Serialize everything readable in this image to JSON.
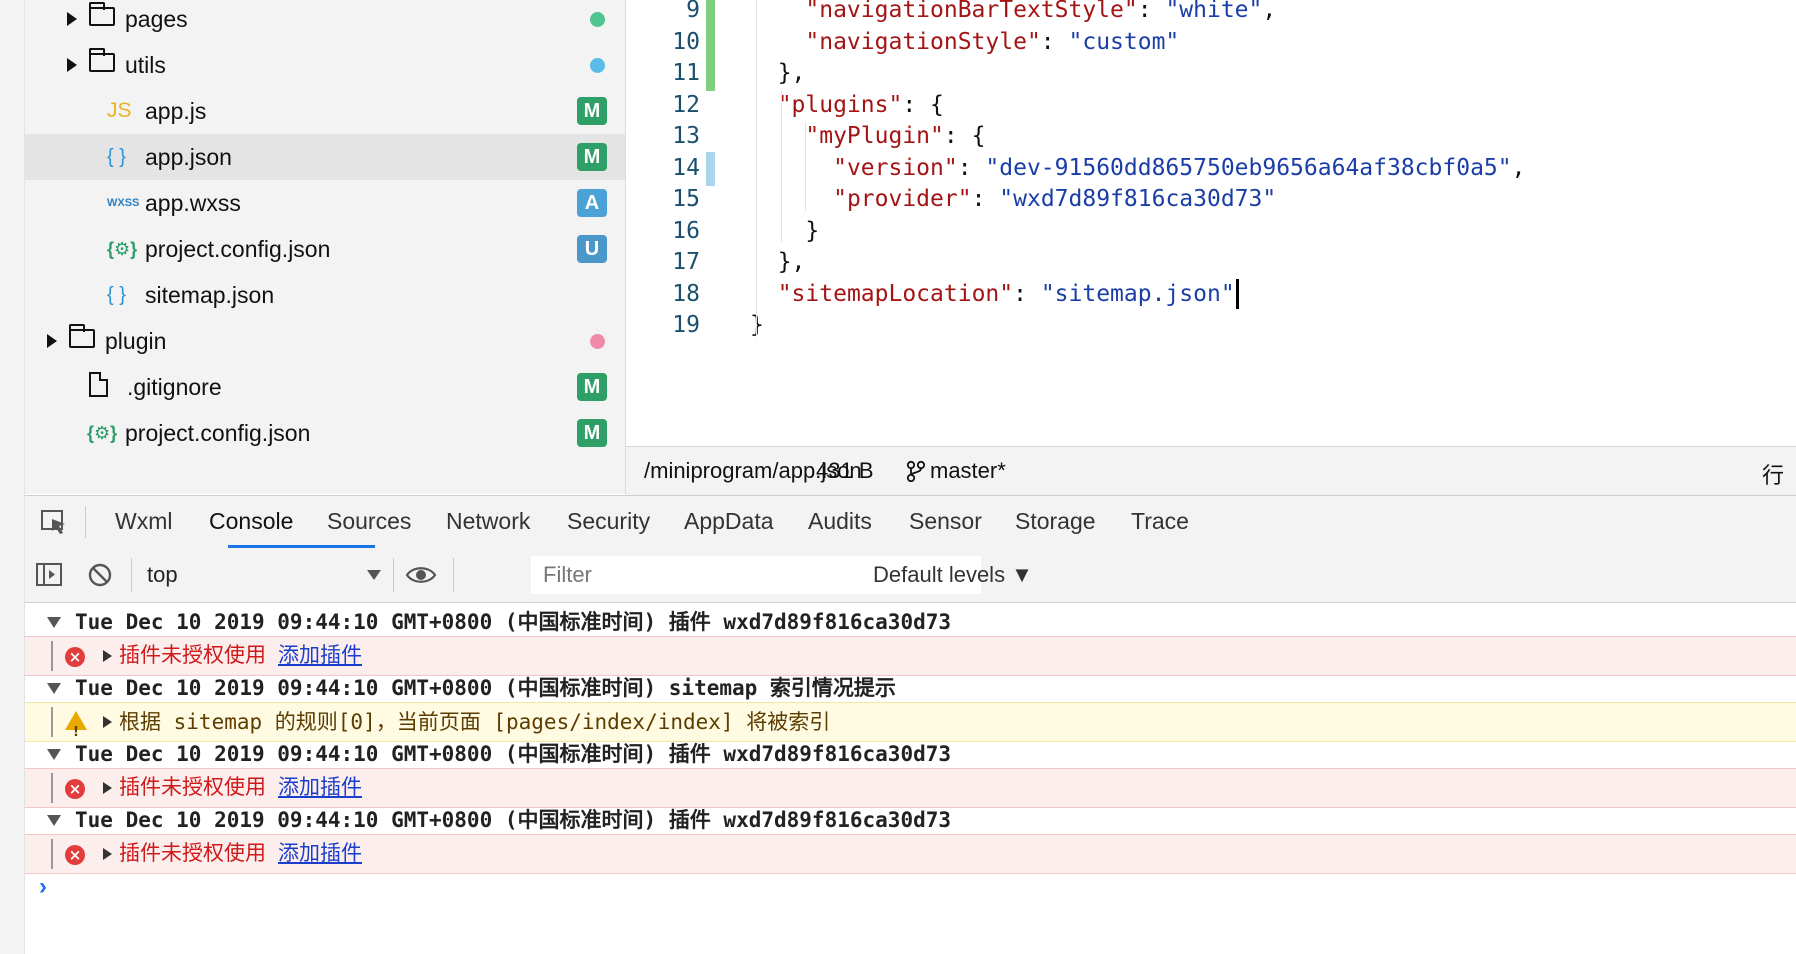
{
  "file_tree": [
    {
      "type": "folder",
      "label": "pages",
      "indent": 1,
      "status": "dot",
      "status_color": "#4fc58f"
    },
    {
      "type": "folder",
      "label": "utils",
      "indent": 1,
      "status": "dot",
      "status_color": "#5bbbe8"
    },
    {
      "type": "js",
      "icon_text": "JS",
      "label": "app.js",
      "indent": 2,
      "status": "badge",
      "badge": "M",
      "badge_color": "#2e9f66"
    },
    {
      "type": "json",
      "icon_text": "{ }",
      "label": "app.json",
      "indent": 2,
      "status": "badge",
      "badge": "M",
      "badge_color": "#2e9f66",
      "selected": true
    },
    {
      "type": "wxss",
      "icon_text": "WXSS",
      "label": "app.wxss",
      "indent": 2,
      "status": "badge",
      "badge": "A",
      "badge_color": "#4aa2d6"
    },
    {
      "type": "config",
      "icon_text": "{⚙}",
      "label": "project.config.json",
      "indent": 2,
      "status": "badge",
      "badge": "U",
      "badge_color": "#4a98c9"
    },
    {
      "type": "json",
      "icon_text": "{ }",
      "label": "sitemap.json",
      "indent": 2,
      "status": "none"
    },
    {
      "type": "folder",
      "label": "plugin",
      "indent": 0,
      "status": "dot",
      "status_color": "#f08aa8"
    },
    {
      "type": "file",
      "label": ".gitignore",
      "indent": 1,
      "status": "badge",
      "badge": "M",
      "badge_color": "#2e9f66"
    },
    {
      "type": "config",
      "icon_text": "{⚙}",
      "label": "project.config.json",
      "indent": 1,
      "status": "badge",
      "badge": "M",
      "badge_color": "#2e9f66"
    }
  ],
  "editor": {
    "lines": [
      {
        "n": "9",
        "indent": "    ",
        "key": "\"navigationBarTextStyle\"",
        "sep": ": ",
        "str": "\"white\"",
        "tail": ",",
        "mark": "#7ed07e"
      },
      {
        "n": "10",
        "indent": "    ",
        "key": "\"navigationStyle\"",
        "sep": ": ",
        "str": "\"custom\"",
        "tail": "",
        "mark": "#7ed07e"
      },
      {
        "n": "11",
        "indent": "  ",
        "key": "",
        "sep": "",
        "str": "",
        "tail": "},",
        "mark": "#7ed07e"
      },
      {
        "n": "12",
        "indent": "  ",
        "key": "\"plugins\"",
        "sep": ": ",
        "str": "",
        "tail": "{",
        "mark": ""
      },
      {
        "n": "13",
        "indent": "    ",
        "key": "\"myPlugin\"",
        "sep": ": ",
        "str": "",
        "tail": "{",
        "mark": ""
      },
      {
        "n": "14",
        "indent": "      ",
        "key": "\"version\"",
        "sep": ": ",
        "str": "\"dev-91560dd865750eb9656a64af38cbf0a5\"",
        "tail": ",",
        "mark": "#a9d6ea"
      },
      {
        "n": "15",
        "indent": "      ",
        "key": "\"provider\"",
        "sep": ": ",
        "str": "\"wxd7d89f816ca30d73\"",
        "tail": "",
        "mark": ""
      },
      {
        "n": "16",
        "indent": "    ",
        "key": "",
        "sep": "",
        "str": "",
        "tail": "}",
        "mark": ""
      },
      {
        "n": "17",
        "indent": "  ",
        "key": "",
        "sep": "",
        "str": "",
        "tail": "},",
        "mark": ""
      },
      {
        "n": "18",
        "indent": "  ",
        "key": "\"sitemapLocation\"",
        "sep": ": ",
        "str": "\"sitemap.json\"",
        "tail": "",
        "mark": "",
        "cursor": true
      },
      {
        "n": "19",
        "indent": "",
        "key": "",
        "sep": "",
        "str": "",
        "tail": "}",
        "mark": ""
      }
    ]
  },
  "statusbar": {
    "path": "/miniprogram/app.json",
    "size": "431 B",
    "branch": "master*",
    "position_label": "行 "
  },
  "devtools": {
    "tabs": [
      "Wxml",
      "Console",
      "Sources",
      "Network",
      "Security",
      "AppData",
      "Audits",
      "Sensor",
      "Storage",
      "Trace"
    ],
    "active_tab": "Console"
  },
  "console_toolbar": {
    "context": "top",
    "filter_placeholder": "Filter",
    "levels": "Default levels ▼"
  },
  "console": {
    "entries": [
      {
        "head": "Tue Dec 10 2019 09:44:10 GMT+0800 (中国标准时间) 插件 wxd7d89f816ca30d73",
        "level": "error",
        "text": "插件未授权使用",
        "link": "添加插件"
      },
      {
        "head": "Tue Dec 10 2019 09:44:10 GMT+0800 (中国标准时间) sitemap 索引情况提示",
        "level": "warn",
        "text": "根据 sitemap 的规则[0]，当前页面 [pages/index/index] 将被索引",
        "link": ""
      },
      {
        "head": "Tue Dec 10 2019 09:44:10 GMT+0800 (中国标准时间) 插件 wxd7d89f816ca30d73",
        "level": "error",
        "text": "插件未授权使用",
        "link": "添加插件"
      },
      {
        "head": "Tue Dec 10 2019 09:44:10 GMT+0800 (中国标准时间) 插件 wxd7d89f816ca30d73",
        "level": "error",
        "text": "插件未授权使用",
        "link": "添加插件"
      }
    ],
    "prompt": "›"
  }
}
